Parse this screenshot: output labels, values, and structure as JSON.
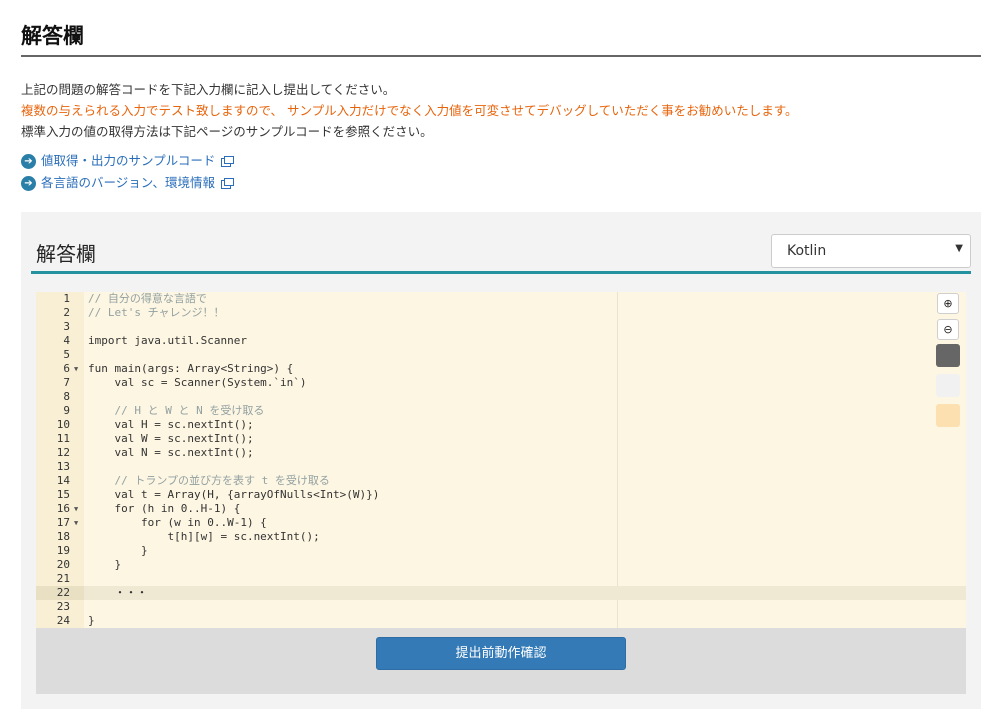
{
  "page": {
    "title": "解答欄"
  },
  "intro": {
    "line1": "上記の問題の解答コードを下記入力欄に記入し提出してください。",
    "line2": "複数の与えられる入力でテスト致しますので、 サンプル入力だけでなく入力値を可変させてデバッグしていただく事をお勧めいたします。",
    "line3": "標準入力の値の取得方法は下記ページのサンプルコードを参照ください。"
  },
  "links": [
    {
      "label": "値取得・出力のサンプルコード"
    },
    {
      "label": "各言語のバージョン、環境情報"
    }
  ],
  "panel": {
    "title": "解答欄",
    "language": "Kotlin",
    "submit_label": "提出前動作確認"
  },
  "editor": {
    "lines": [
      {
        "n": "1",
        "text": "// 自分の得意な言語で",
        "comment": true
      },
      {
        "n": "2",
        "text": "// Let's チャレンジ！！",
        "comment": true
      },
      {
        "n": "3",
        "text": ""
      },
      {
        "n": "4",
        "text": "import java.util.Scanner"
      },
      {
        "n": "5",
        "text": ""
      },
      {
        "n": "6",
        "text": "fun main(args: Array<String>) {",
        "fold": true
      },
      {
        "n": "7",
        "text": "    val sc = Scanner(System.`in`)"
      },
      {
        "n": "8",
        "text": ""
      },
      {
        "n": "9",
        "text": "    // H と W と N を受け取る",
        "comment": true
      },
      {
        "n": "10",
        "text": "    val H = sc.nextInt();"
      },
      {
        "n": "11",
        "text": "    val W = sc.nextInt();"
      },
      {
        "n": "12",
        "text": "    val N = sc.nextInt();"
      },
      {
        "n": "13",
        "text": ""
      },
      {
        "n": "14",
        "text": "    // トランプの並び方を表す t を受け取る",
        "comment": true
      },
      {
        "n": "15",
        "text": "    val t = Array(H, {arrayOfNulls<Int>(W)})"
      },
      {
        "n": "16",
        "text": "    for (h in 0..H-1) {",
        "fold": true
      },
      {
        "n": "17",
        "text": "        for (w in 0..W-1) {",
        "fold": true
      },
      {
        "n": "18",
        "text": "            t[h][w] = sc.nextInt();"
      },
      {
        "n": "19",
        "text": "        }"
      },
      {
        "n": "20",
        "text": "    }"
      },
      {
        "n": "21",
        "text": ""
      },
      {
        "n": "22",
        "text": "    ・・・",
        "active": true
      },
      {
        "n": "23",
        "text": ""
      },
      {
        "n": "24",
        "text": "}"
      }
    ]
  },
  "colors": {
    "accent": "#2592a2",
    "warning": "#e8640c",
    "button": "#337ab7",
    "editor_bg": "#fdf6e3",
    "swatches": [
      "#666666",
      "#f1f1f1",
      "#fde0b0"
    ]
  },
  "icons": {
    "zoom_in": "zoom-in-icon",
    "zoom_out": "zoom-out-icon",
    "link_arrow": "arrow-right-circle-icon",
    "external": "external-window-icon"
  }
}
